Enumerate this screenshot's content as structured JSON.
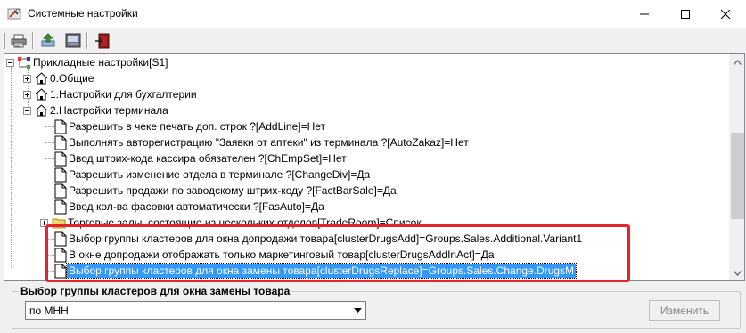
{
  "window": {
    "title": "Системные настройки",
    "app_icon": "settings-tools-icon"
  },
  "toolbar": {
    "buttons": [
      {
        "name": "print",
        "icon": "printer-icon"
      },
      {
        "name": "send",
        "icon": "send-icon"
      },
      {
        "name": "config",
        "icon": "config-panel-icon"
      },
      {
        "name": "exit",
        "icon": "exit-door-icon"
      }
    ]
  },
  "tree": {
    "root": {
      "label": "Прикладные настройки[S1]",
      "icon": "tree-root-icon"
    },
    "nodes": [
      {
        "label": "0.Общие",
        "icon": "home-icon",
        "expanded": false
      },
      {
        "label": "1.Настройки для бухгалтерии",
        "icon": "home-icon",
        "expanded": false
      },
      {
        "label": "2.Настройки терминала",
        "icon": "home-icon",
        "expanded": true
      }
    ],
    "terminal_items": [
      {
        "label": "Разрешить в чеке печать доп. строк ?[AddLine]=Нет"
      },
      {
        "label": "Выполнять авторегистрацию \"Заявки от аптеки\" из терминала ?[AutoZakaz]=Нет"
      },
      {
        "label": "Ввод штрих-кода кассира обязателен ?[ChEmpSet]=Нет"
      },
      {
        "label": "Разрешить изменение отдела в терминале ?[ChangeDiv]=Да"
      },
      {
        "label": "Разрешить продажи по заводскому штрих-коду ?[FactBarSale]=Да"
      },
      {
        "label": "Ввод кол-ва фасовки автоматически ?[FasAuto]=Да"
      },
      {
        "label": "Торговые залы, состоящие из нескольких отделов[TradeRoom]=Список"
      },
      {
        "label": "Выбор группы кластеров для окна допродажи товара[clusterDrugsAdd]=Groups.Sales.Additional.Variant1"
      },
      {
        "label": "В окне допродажи отображать только маркетинговый товар[clusterDrugsAddInAct]=Да"
      },
      {
        "label": "Выбор группы кластеров для окна замены товара[clusterDrugsReplace]=Groups.Sales.Change.DrugsM"
      }
    ],
    "selected_index": 9,
    "highlight_color": "#e5232d",
    "selection_color": "#3399ff"
  },
  "editor": {
    "group_title": "Выбор группы кластеров для окна замены товара",
    "selected_value": "по МНН",
    "apply_label": "Изменить"
  }
}
